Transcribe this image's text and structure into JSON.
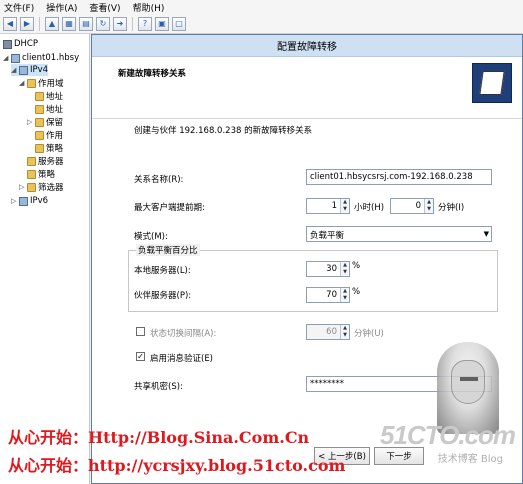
{
  "menu": [
    "文件(F)",
    "操作(A)",
    "查看(V)",
    "帮助(H)"
  ],
  "toolbar_icons": [
    "back-icon",
    "forward-icon",
    "up-folder-icon",
    "show-tree-icon",
    "properties-icon",
    "refresh-icon",
    "export-icon",
    "help-icon",
    "console-icon",
    "new-window-icon"
  ],
  "tree": {
    "root": "DHCP",
    "server": "client01.hbsy",
    "ipv4": "IPv4",
    "scope": "作用域",
    "addr1": "地址",
    "addr2": "地址",
    "reserve": "保留",
    "options": "作用",
    "policy_sub": "策略",
    "server_options": "服务器",
    "policies": "策略",
    "filters": "筛选器",
    "ipv6": "IPv6"
  },
  "dialog": {
    "title": "配置故障转移",
    "header": "新建故障转移关系",
    "intro": "创建与伙伴 192.168.0.238 的新故障转移关系",
    "relationship_label": "关系名称(R):",
    "relationship_value": "client01.hbsycsrsj.com-192.168.0.238",
    "mclt_label": "最大客户端提前期:",
    "mclt_hours": "1",
    "hours_label": "小时(H)",
    "mclt_minutes": "0",
    "minutes_label": "分钟(I)",
    "mode_label": "模式(M):",
    "mode_value": "负载平衡",
    "lb_group_title": "负载平衡百分比",
    "local_label": "本地服务器(L):",
    "local_value": "30",
    "percent1": "%",
    "partner_label": "伙伴服务器(P):",
    "partner_value": "70",
    "percent2": "%",
    "state_switch_label": "状态切换间隔(A):",
    "state_switch_value": "60",
    "state_switch_unit": "分钟(U)",
    "state_switch_checked": false,
    "auth_label": "启用消息验证(E)",
    "auth_checked": true,
    "secret_label": "共享机密(S):",
    "secret_value": "********",
    "back_button": "< 上一步(B)",
    "next_button": "下一步"
  },
  "watermark": {
    "line1": "从心开始：Http://Blog.Sina.Com.Cn",
    "line2": "从心开始：http://ycrsjxy.blog.51cto.com",
    "logo": "51CTO.com",
    "logo_sub": "技术博客 Blog"
  }
}
